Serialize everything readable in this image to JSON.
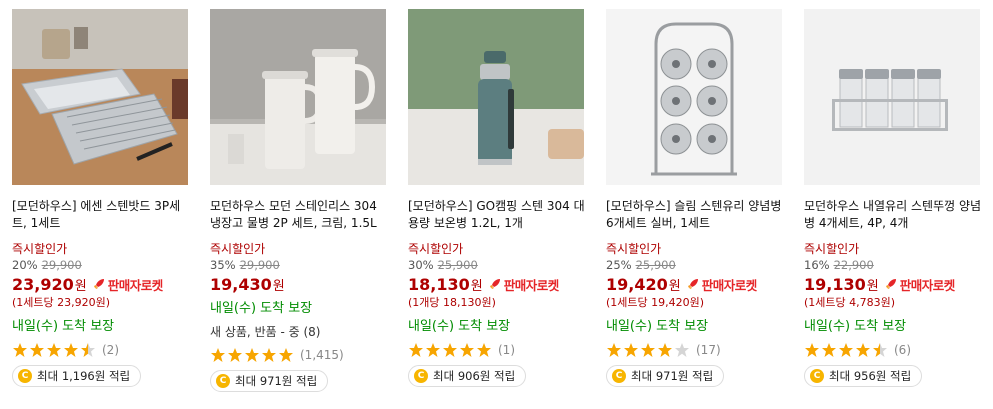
{
  "colors": {
    "price": "#ae0000",
    "delivery": "#008c00",
    "star": "#f7a500",
    "rocket": "#e52528"
  },
  "products": [
    {
      "name": "[모던하우스] 에센 스텐밧드 3P세트, 1세트",
      "instant": "즉시할인가",
      "discount": "20%",
      "original_price": "29,900",
      "price": "23,920",
      "won": "원",
      "rocket": "판매자로켓",
      "unit_price": "(1세트당 23,920원)",
      "delivery": "내일(수) 도착 보장",
      "rating": 4.5,
      "review_count": "(2)",
      "point": "최대 1,196원 적립"
    },
    {
      "name": "모던하우스 모던 스테인리스 304 냉장고 물병 2P 세트, 크림, 1.5L",
      "instant": "즉시할인가",
      "discount": "35%",
      "original_price": "29,900",
      "price": "19,430",
      "won": "원",
      "delivery": "내일(수) 도착 보장",
      "review_sub": "새 상품, 반품 - 중 (8)",
      "rating": 5,
      "review_count": "(1,415)",
      "point": "최대 971원 적립"
    },
    {
      "name": "[모던하우스] GO캠핑 스텐 304 대용량 보온병 1.2L, 1개",
      "instant": "즉시할인가",
      "discount": "30%",
      "original_price": "25,900",
      "price": "18,130",
      "won": "원",
      "rocket": "판매자로켓",
      "unit_price": "(1개당 18,130원)",
      "delivery": "내일(수) 도착 보장",
      "rating": 5,
      "review_count": "(1)",
      "point": "최대 906원 적립"
    },
    {
      "name": "[모던하우스] 슬림 스텐유리 양념병 6개세트 실버, 1세트",
      "instant": "즉시할인가",
      "discount": "25%",
      "original_price": "25,900",
      "price": "19,420",
      "won": "원",
      "rocket": "판매자로켓",
      "unit_price": "(1세트당 19,420원)",
      "delivery": "내일(수) 도착 보장",
      "rating": 4,
      "review_count": "(17)",
      "point": "최대 971원 적립"
    },
    {
      "name": "모던하우스 내열유리 스텐뚜껑 양념병 4개세트, 4P, 4개",
      "instant": "즉시할인가",
      "discount": "16%",
      "original_price": "22,900",
      "price": "19,130",
      "won": "원",
      "rocket": "판매자로켓",
      "unit_price": "(1세트당 4,783원)",
      "delivery": "내일(수) 도착 보장",
      "rating": 4.5,
      "review_count": "(6)",
      "point": "최대 956원 적립"
    }
  ]
}
